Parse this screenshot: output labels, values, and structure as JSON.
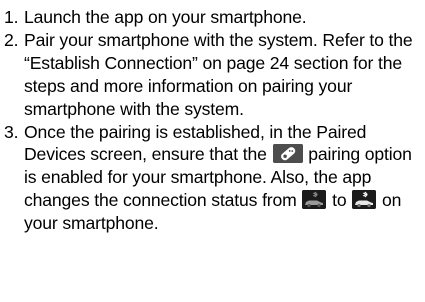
{
  "steps": [
    {
      "number": "1.",
      "text": "Launch the app on your smartphone."
    },
    {
      "number": "2.",
      "text": "Pair your smartphone with the system. Refer to the “Establish Connection” on page 24 section for the steps and more information on pairing your smartphone with the system."
    },
    {
      "number": "3.",
      "text_before_icon": "Once the pairing is established, in the Paired Devices screen, ensure that the",
      "text_after_icon": "pairing option is enabled for your smartphone. Also, the app changes the connection status from",
      "text_between_icons": "to",
      "text_end": "on your smartphone."
    }
  ],
  "icons": {
    "pairing_option": "smartphone-app-pairing-icon",
    "status_from": "car-bluetooth-disconnected-icon",
    "status_to": "car-bluetooth-connected-icon"
  }
}
